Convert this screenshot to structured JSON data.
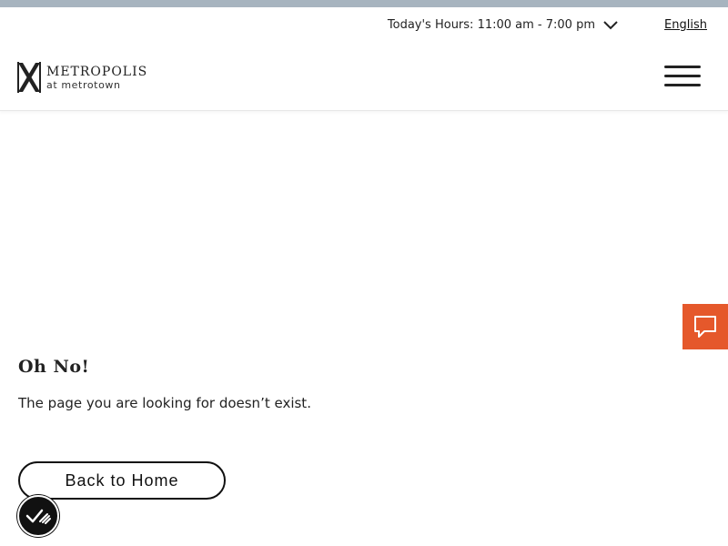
{
  "utility": {
    "hours_text": "Today's Hours: 11:00 am - 7:00 pm",
    "language": "English"
  },
  "brand": {
    "name": "METROPOLIS",
    "sub": "at metrotown"
  },
  "icons": {
    "hours_toggle": "chevron-down-icon",
    "menu": "hamburger-menu-icon",
    "chat": "chat-bubble-icon",
    "accessibility": "accessibility-check-icon"
  },
  "main": {
    "title": "Oh No!",
    "description": "The page you are looking for doesn’t exist.",
    "home_button": "Back to Home"
  },
  "colors": {
    "top_stripe": "#a7b4bf",
    "chat_accent": "#e5582b",
    "text": "#1a1a1a"
  }
}
